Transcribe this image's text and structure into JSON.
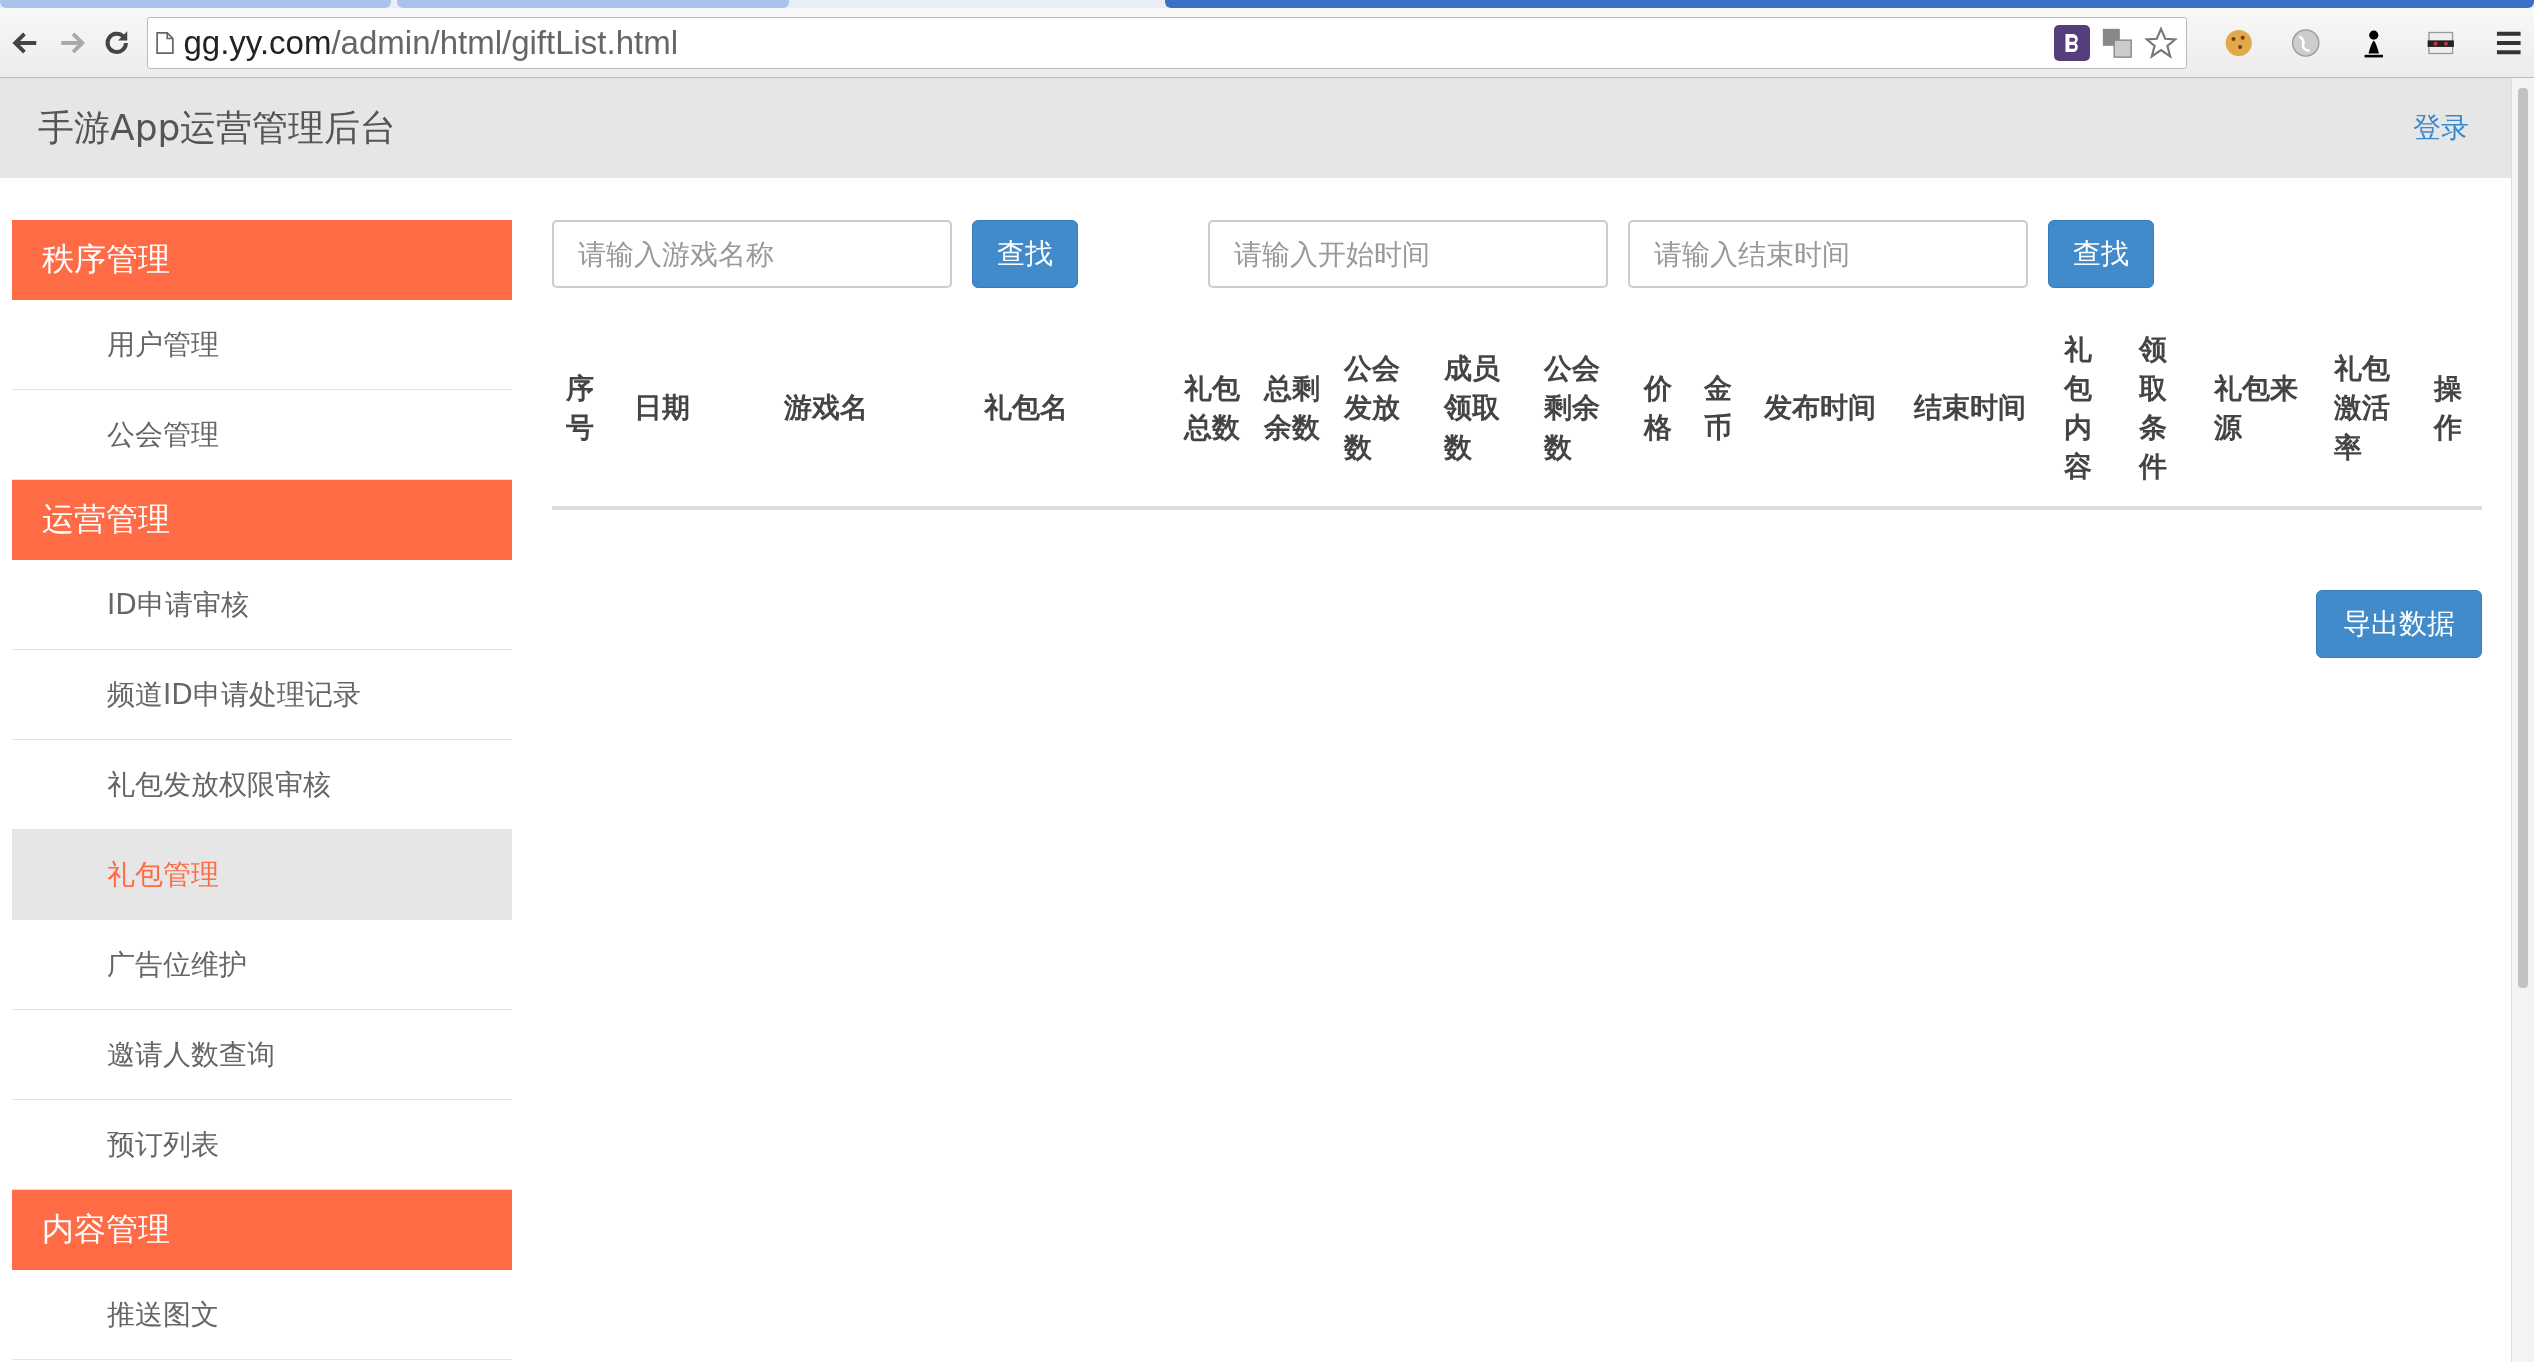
{
  "browser": {
    "tabs": [
      {
        "selected": false
      },
      {
        "selected": false
      },
      {
        "selected": true
      }
    ],
    "url_host": "gg.yy.com",
    "url_path": "/admin/html/giftList.html"
  },
  "header": {
    "title": "手游App运营管理后台",
    "login": "登录"
  },
  "sidebar": [
    {
      "title": "秩序管理",
      "items": [
        {
          "label": "用户管理",
          "selected": false
        },
        {
          "label": "公会管理",
          "selected": false
        }
      ]
    },
    {
      "title": "运营管理",
      "items": [
        {
          "label": "ID申请审核",
          "selected": false
        },
        {
          "label": "频道ID申请处理记录",
          "selected": false
        },
        {
          "label": "礼包发放权限审核",
          "selected": false
        },
        {
          "label": "礼包管理",
          "selected": true
        },
        {
          "label": "广告位维护",
          "selected": false
        },
        {
          "label": "邀请人数查询",
          "selected": false
        },
        {
          "label": "预订列表",
          "selected": false
        }
      ]
    },
    {
      "title": "内容管理",
      "items": [
        {
          "label": "推送图文",
          "selected": false
        }
      ]
    }
  ],
  "search": {
    "game_placeholder": "请输入游戏名称",
    "search_button": "查找",
    "start_placeholder": "请输入开始时间",
    "end_placeholder": "请输入结束时间",
    "time_search_button": "查找"
  },
  "table": {
    "columns": [
      "序号",
      "日期",
      "游戏名",
      "礼包名",
      "礼包总数",
      "总剩余数",
      "公会发放数",
      "成员领取数",
      "公会剩余数",
      "价格",
      "金币",
      "发布时间",
      "结束时间",
      "礼包内容",
      "领取条件",
      "礼包来源",
      "礼包激活率",
      "操作"
    ]
  },
  "export_button": "导出数据"
}
